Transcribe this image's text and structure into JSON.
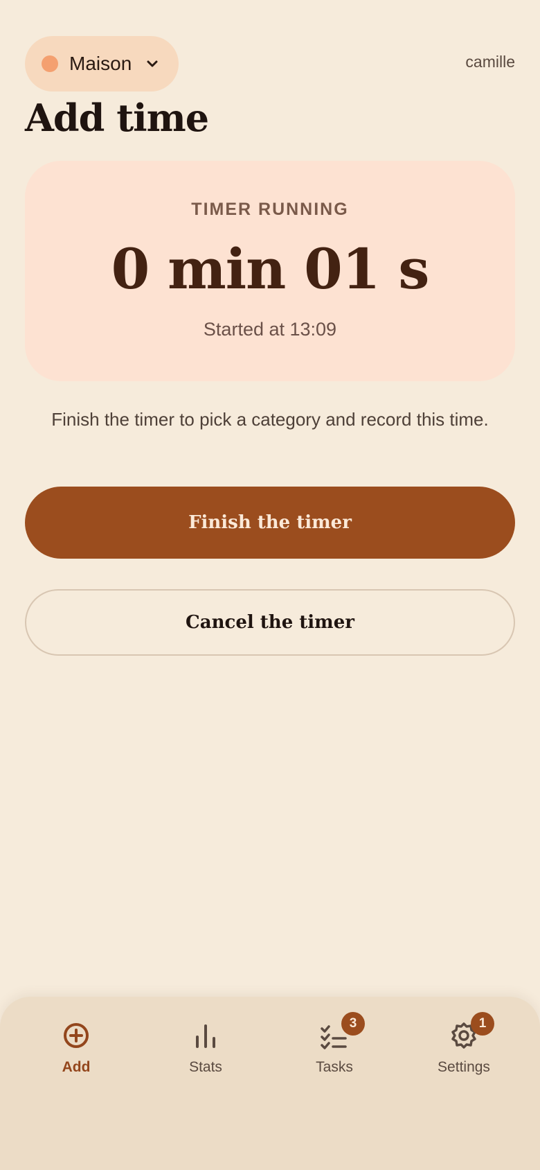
{
  "header": {
    "household": "Maison",
    "household_dot_color": "#f4a070",
    "username": "camille",
    "page_title": "Add time"
  },
  "timer": {
    "status": "TIMER RUNNING",
    "elapsed": "0 min 01 s",
    "started": "Started at 13:09"
  },
  "helper_text": "Finish the timer to pick a category and record this time.",
  "actions": {
    "finish_label": "Finish the timer",
    "cancel_label": "Cancel the timer"
  },
  "nav": {
    "items": [
      {
        "label": "Add",
        "icon": "plus-circle-icon",
        "active": true
      },
      {
        "label": "Stats",
        "icon": "bar-chart-icon",
        "active": false
      },
      {
        "label": "Tasks",
        "icon": "checklist-icon",
        "badge": "3",
        "active": false
      },
      {
        "label": "Settings",
        "icon": "gear-icon",
        "badge": "1",
        "active": false
      }
    ]
  },
  "colors": {
    "background": "#f6ebdb",
    "accent": "#9b4d1e",
    "card": "#fde2d2"
  }
}
